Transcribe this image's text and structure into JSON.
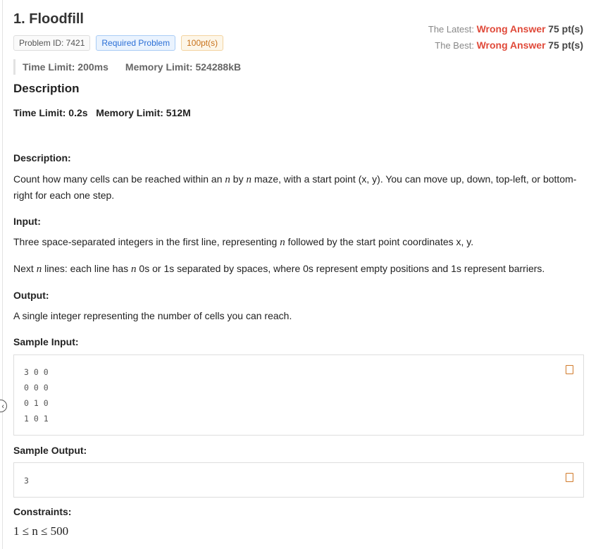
{
  "title": "1.  Floodfill",
  "badges": {
    "id": "Problem ID: 7421",
    "required": "Required Problem",
    "points": "100pt(s)"
  },
  "status": {
    "latest_label": "The Latest:",
    "latest_verdict": "Wrong Answer",
    "latest_points": "75 pt(s)",
    "best_label": "The Best:",
    "best_verdict": "Wrong Answer",
    "best_points": "75 pt(s)"
  },
  "limits": {
    "time": "Time Limit: 200ms",
    "memory": "Memory Limit: 524288kB"
  },
  "description_heading": "Description",
  "limits_line": "Time Limit: 0.2s   Memory Limit: 512M",
  "sections": {
    "desc_h": "Description:",
    "desc_1": "Count how many cells can be reached within an ",
    "n": "n",
    "by": " by ",
    "desc_2": " maze, with a start point (x, y). You can move up, down, top-left, or bottom-right for each one step.",
    "input_h": "Input:",
    "input_1a": "Three space-separated integers in the first line, representing ",
    "input_1b": " followed by the start point coordinates x, y.",
    "input_2a": "Next ",
    "input_2b": " lines: each line has ",
    "input_2c": " 0s or 1s separated by spaces, where 0s represent empty positions and 1s represent barriers.",
    "output_h": "Output:",
    "output_1": "A single integer representing the number of cells you can reach.",
    "sample_in_h": "Sample Input:",
    "sample_in": [
      "3 0 0",
      "0 0 0",
      "0 1 0",
      "1 0 1"
    ],
    "sample_out_h": "Sample Output:",
    "sample_out": "3",
    "constraints_h": "Constraints:",
    "constraints": "1 ≤ n ≤ 500"
  }
}
